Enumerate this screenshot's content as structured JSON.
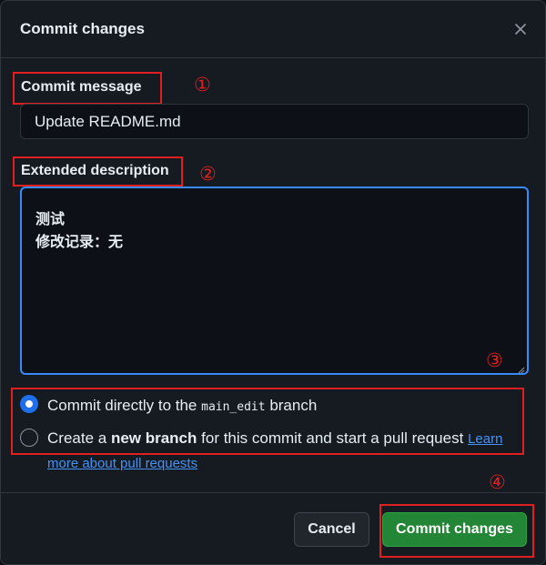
{
  "dialog": {
    "title": "Commit changes",
    "close_icon": "close-icon"
  },
  "commit_message": {
    "label": "Commit message",
    "value": "Update README.md"
  },
  "extended_description": {
    "label": "Extended description",
    "lines": [
      "测试",
      "修改记录：无"
    ]
  },
  "branch_options": {
    "direct": {
      "prefix": "Commit directly to the",
      "branch": "main_edit",
      "suffix": "branch",
      "selected": true
    },
    "new_branch": {
      "prefix": "Create a",
      "bold": "new branch",
      "suffix": "for this commit and start a pull request",
      "link_part1": "Learn",
      "link_part2": "more about pull requests",
      "selected": false
    }
  },
  "annotations": {
    "marker_1": "①",
    "marker_2": "②",
    "marker_3": "③",
    "marker_4": "④",
    "color": "#e02020"
  },
  "buttons": {
    "cancel": "Cancel",
    "commit": "Commit changes"
  },
  "colors": {
    "accent": "#1f6feb",
    "primary_button": "#238636",
    "focus_border": "#388bfd"
  }
}
